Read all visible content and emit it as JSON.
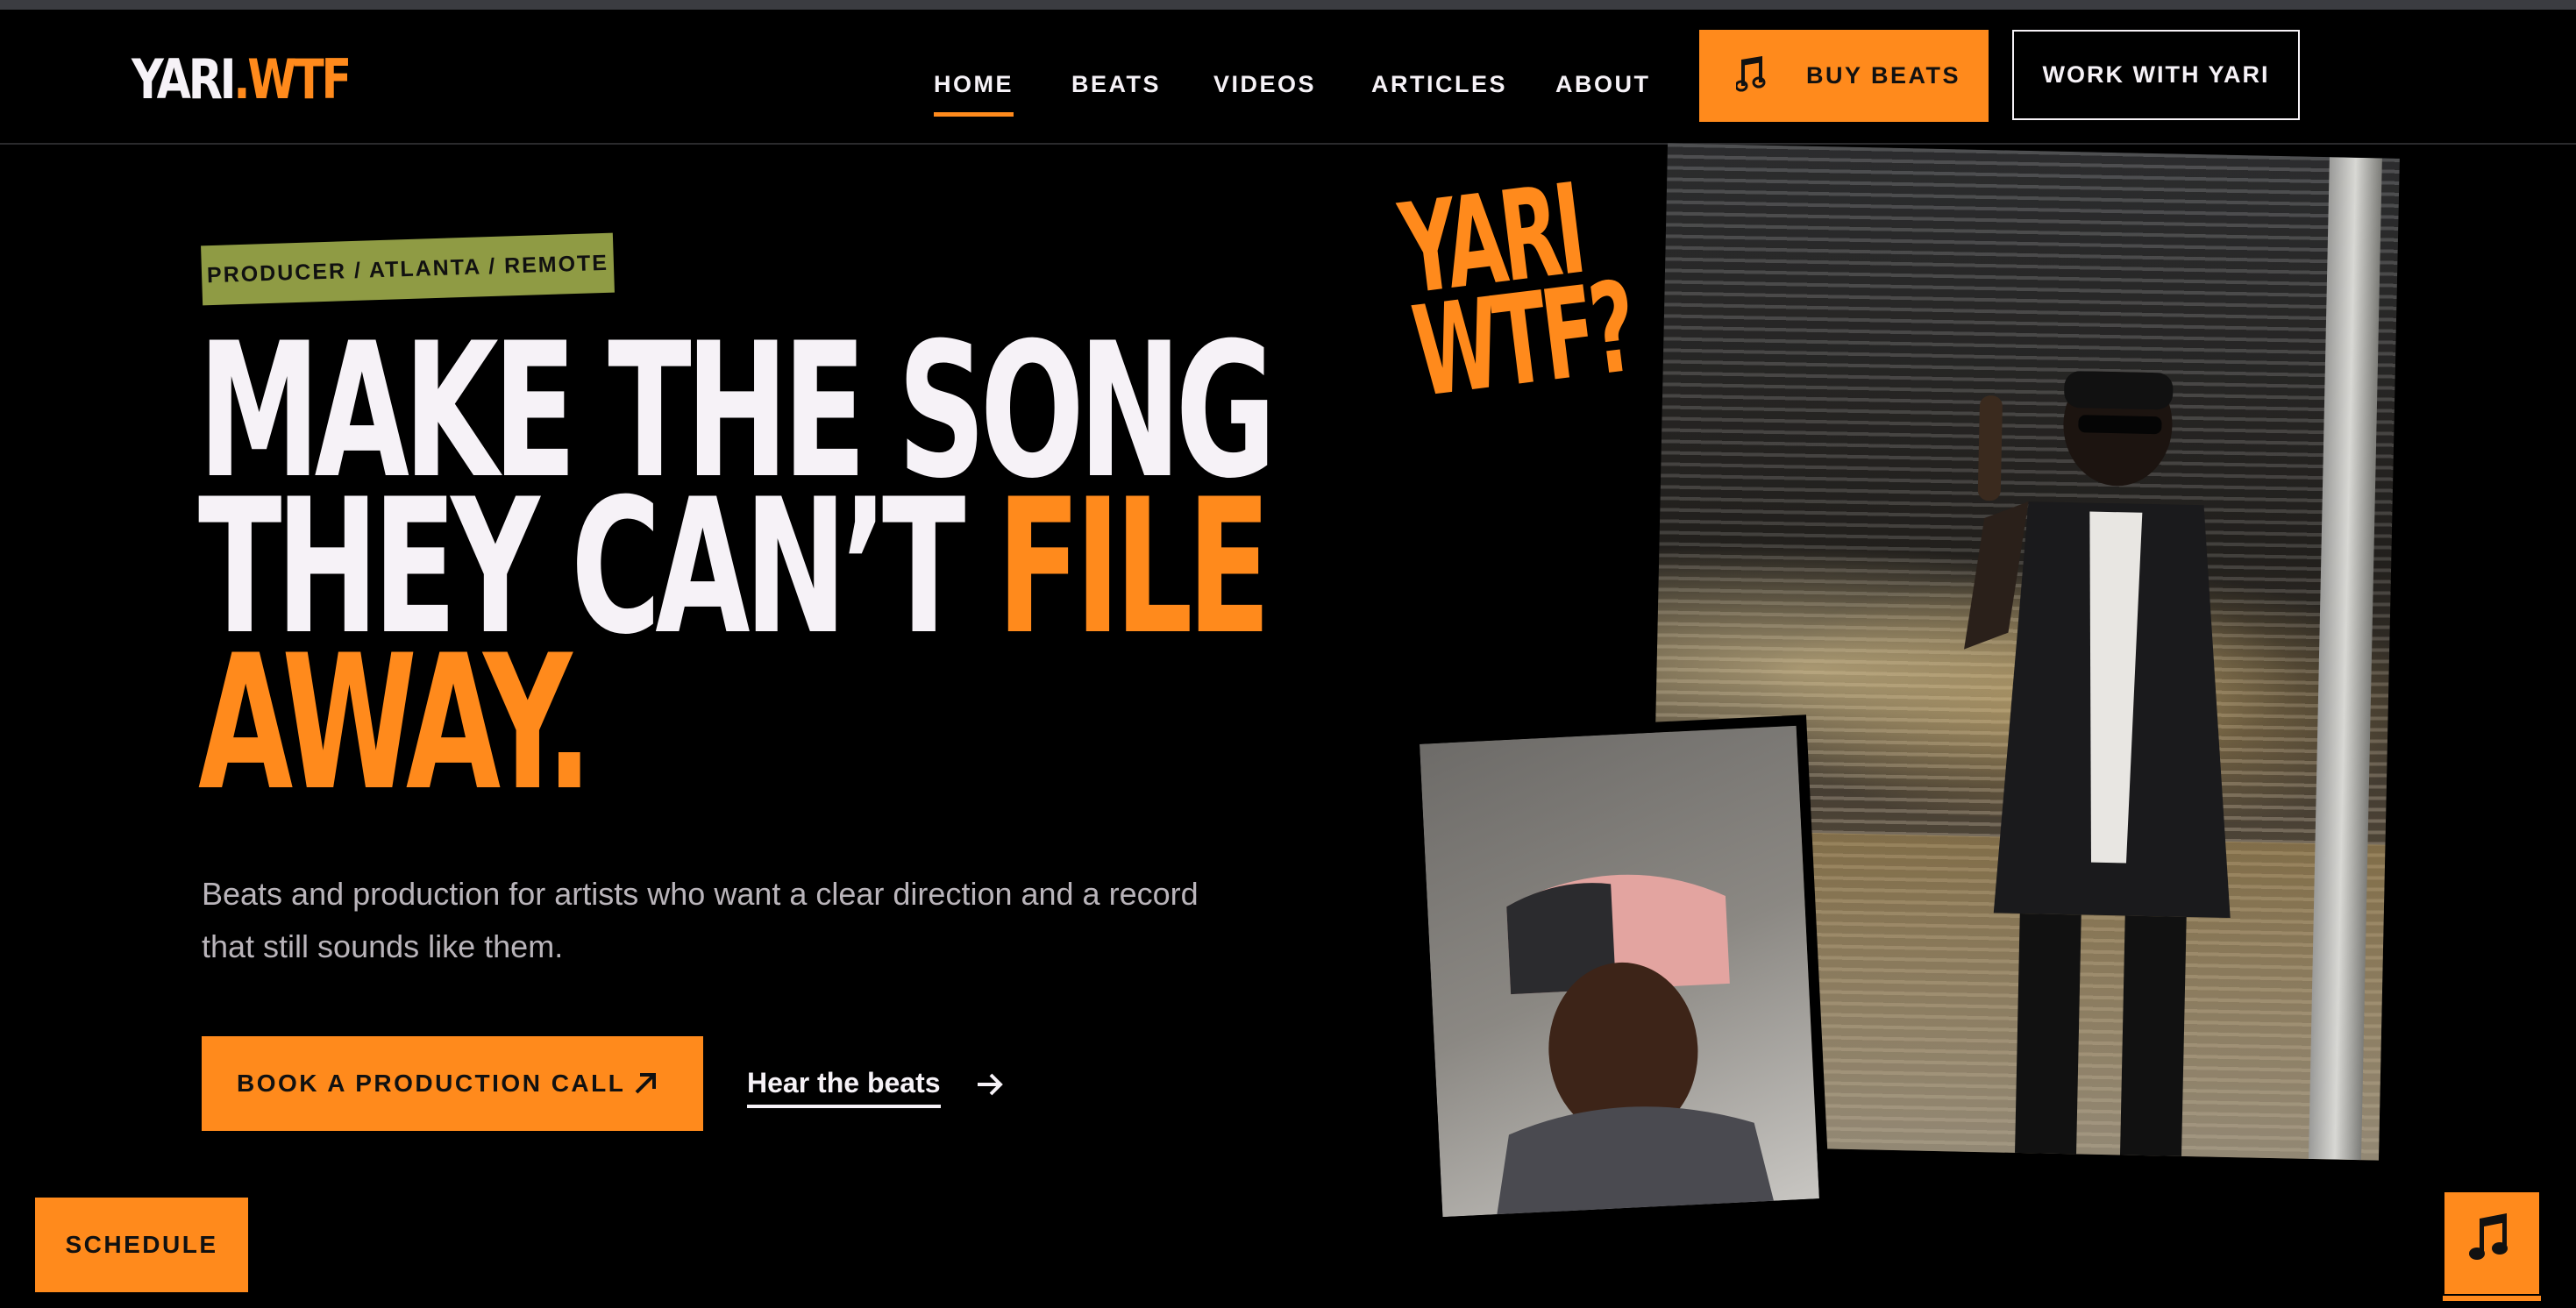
{
  "brand": {
    "logo_white": "YARI",
    "logo_orange": ".WTF"
  },
  "nav": {
    "items": [
      {
        "label": "HOME",
        "active": true
      },
      {
        "label": "BEATS",
        "active": false
      },
      {
        "label": "VIDEOS",
        "active": false
      },
      {
        "label": "ARTICLES",
        "active": false
      },
      {
        "label": "ABOUT",
        "active": false
      }
    ],
    "buy_beats": "BUY BEATS",
    "buy_beats_icon": "music-note-icon",
    "work_with": "WORK WITH YARI"
  },
  "hero": {
    "tag": "PRODUCER / ATLANTA / REMOTE",
    "headline": {
      "line1": "MAKE THE SONG",
      "line2_white": "THEY CAN’T ",
      "line2_orange": "FILE",
      "line3_orange": "AWAY."
    },
    "lede": "Beats and production for artists who want a clear direction and a record that still sounds like them.",
    "cta_primary": "BOOK A PRODUCTION CALL",
    "cta_primary_icon": "arrow-up-right-icon",
    "cta_secondary": "Hear the beats",
    "cta_secondary_icon": "arrow-right-icon",
    "stamp_line1": "YARI",
    "stamp_line2": "WTF?"
  },
  "floating": {
    "schedule": "SCHEDULE",
    "music_icon": "music-note-icon"
  },
  "colors": {
    "accent": "#ff8a1c",
    "tag_bg": "#8f9b44",
    "background": "#000000",
    "text": "#f6f2f7"
  }
}
